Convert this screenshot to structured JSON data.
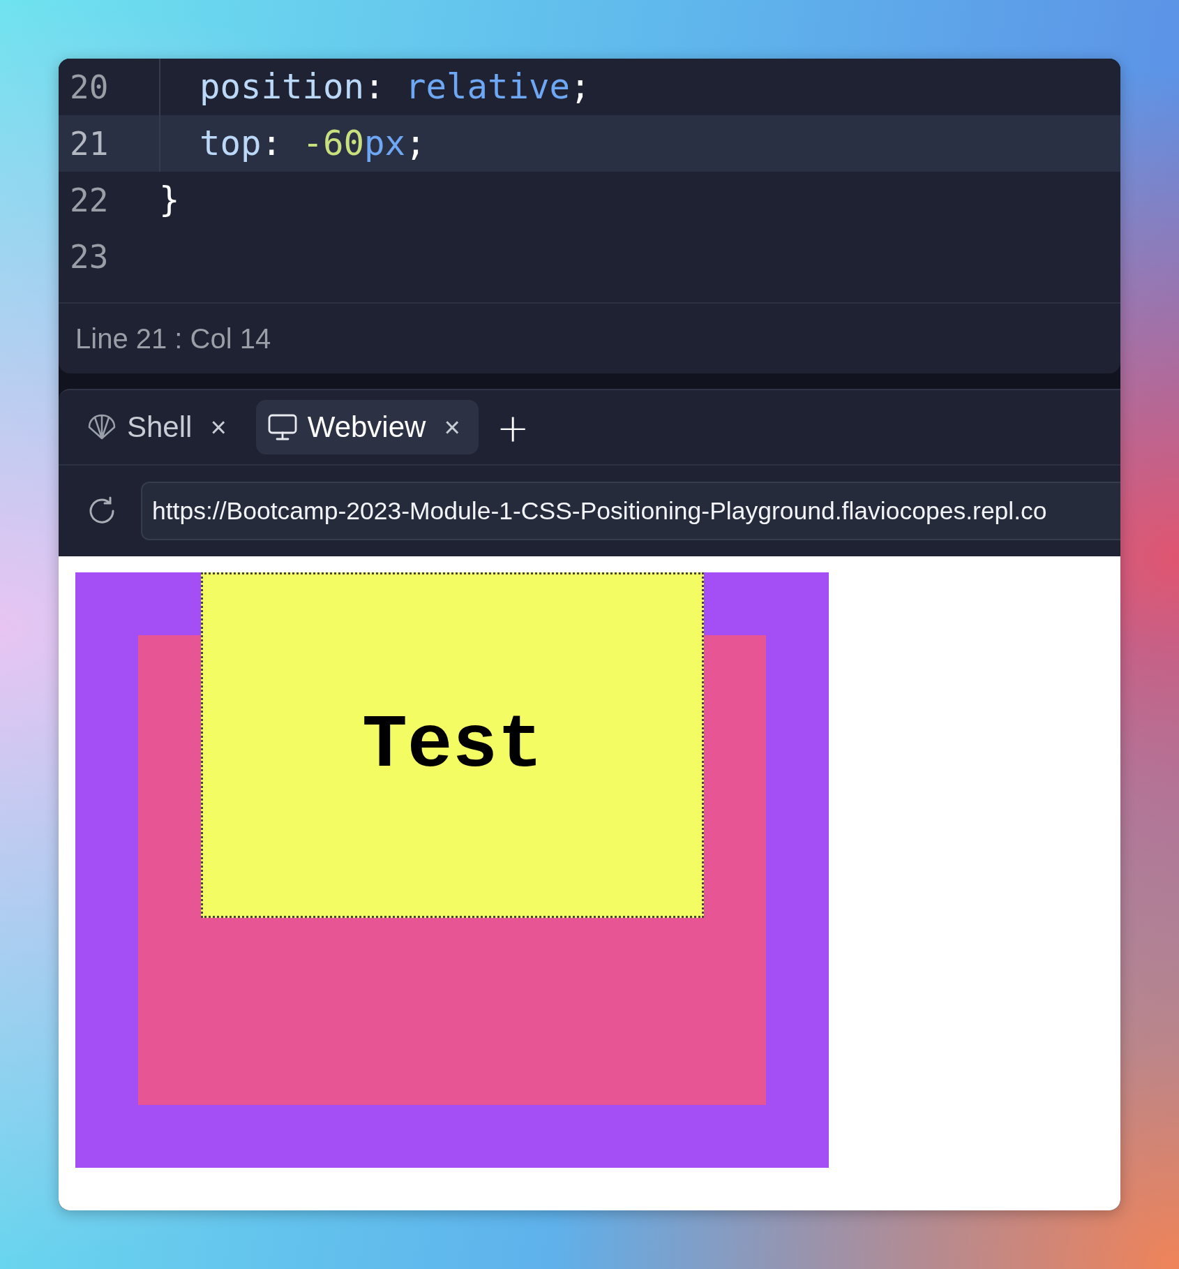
{
  "editor": {
    "lines": [
      {
        "number": "20",
        "active": false,
        "indent_guide": true,
        "tokens": [
          {
            "kind": "property",
            "text": "position"
          },
          {
            "kind": "punct",
            "text": ": "
          },
          {
            "kind": "keyword",
            "text": "relative"
          },
          {
            "kind": "punct",
            "text": ";"
          }
        ]
      },
      {
        "number": "21",
        "active": true,
        "indent_guide": true,
        "tokens": [
          {
            "kind": "property",
            "text": "top"
          },
          {
            "kind": "punct",
            "text": ": "
          },
          {
            "kind": "number",
            "text": "-60"
          },
          {
            "kind": "keyword",
            "text": "px"
          },
          {
            "kind": "punct",
            "text": ";"
          }
        ]
      },
      {
        "number": "22",
        "active": false,
        "indent_guide": false,
        "tokens": [
          {
            "kind": "punct",
            "text": "}"
          }
        ]
      },
      {
        "number": "23",
        "active": false,
        "indent_guide": false
      }
    ],
    "status_bar": "Line 21 : Col 14"
  },
  "panel": {
    "tabs": [
      {
        "kind": "shell",
        "label": "Shell",
        "close": "×",
        "selected": false
      },
      {
        "kind": "webview",
        "label": "Webview",
        "close": "×",
        "selected": true
      }
    ],
    "add_tab": "+",
    "address": {
      "value": "https://Bootcamp-2023-Module-1-CSS-Positioning-Playground.flaviocopes.repl.co"
    },
    "preview": {
      "label": "Test"
    }
  }
}
